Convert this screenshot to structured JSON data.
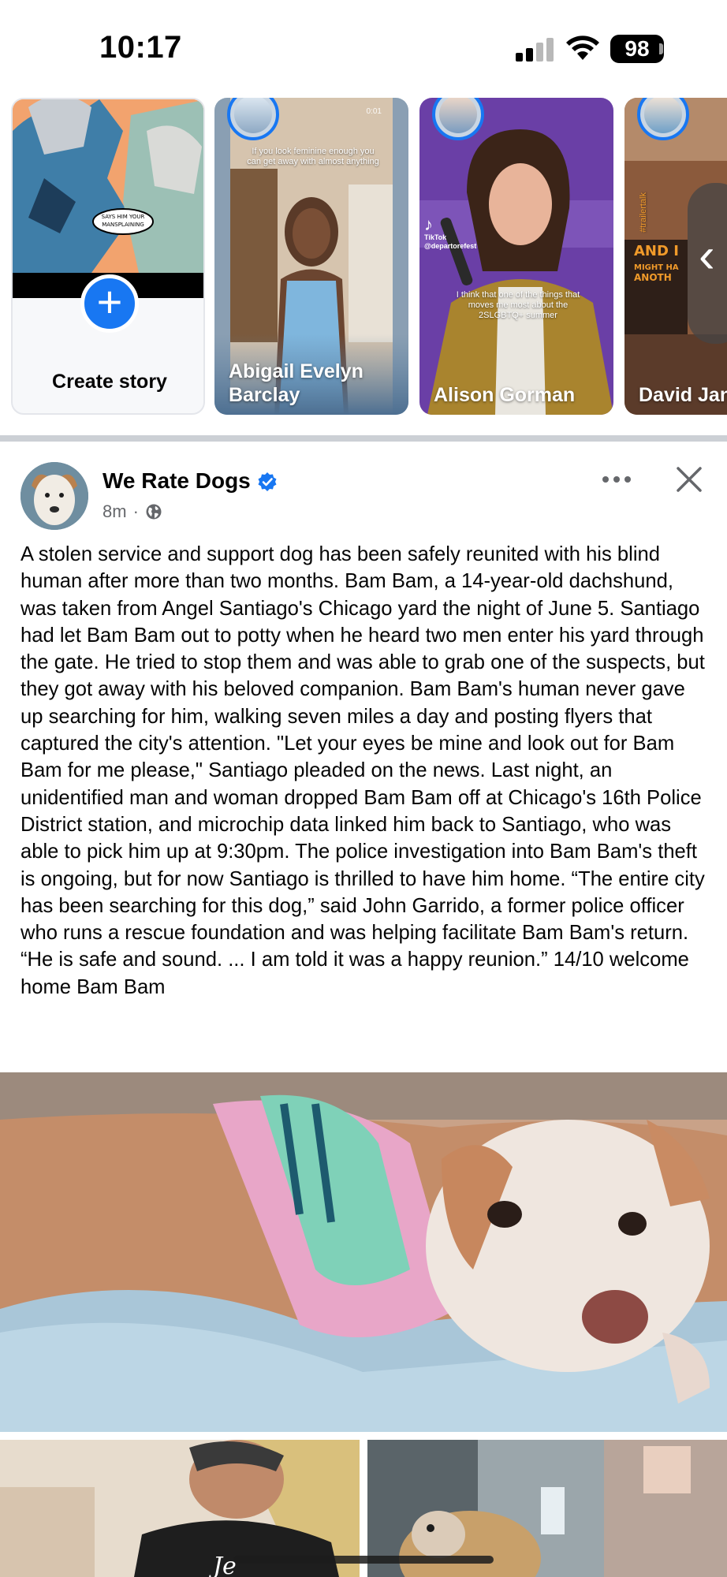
{
  "status_bar": {
    "time": "10:17",
    "battery": "98"
  },
  "stories": {
    "create_label": "Create story",
    "comic_text": "IT SAYS \"HIM YOUR MANSPLAINING\"",
    "items": [
      {
        "name": "Abigail Evelyn Barclay",
        "caption": "If you look feminine enough you can get away with almost anything",
        "time": "0:01"
      },
      {
        "name": "Alison Gorman",
        "caption": "I think that one of the things that moves me most about the 2SLGBTQ+ summer",
        "tiktok_label": "TikTok",
        "tiktok_handle": "@departorefest"
      },
      {
        "name": "David Jan Lewis",
        "tag": "#trailertalk"
      }
    ]
  },
  "post": {
    "author": "We Rate Dogs",
    "time": "8m",
    "body": "A stolen service and support dog has been safely reunited with his blind human after more than two months. Bam Bam, a 14-year-old dachshund, was taken from Angel Santiago's Chicago yard the night of June 5. Santiago had let Bam Bam out to potty when he heard two men enter his yard through the gate. He tried to stop them and was able to grab one of the suspects, but they got away with his beloved companion. Bam Bam's human never gave up searching for him, walking seven miles a day and posting flyers that captured the city's attention. \"Let your eyes be mine and look out for Bam Bam for me please,\" Santiago pleaded on the news. Last night, an unidentified man and woman dropped Bam Bam off at Chicago's 16th Police District station, and microchip data linked him back to Santiago, who was able to pick him up at 9:30pm. The police investigation into Bam Bam's theft is ongoing, but for now Santiago is thrilled to have him home. “The entire city has been searching for this dog,” said John Garrido, a former police officer who runs a rescue foundation and was helping facilitate Bam Bam's return. “He is safe and sound. ... I am told it was a happy reunion.” 14/10 welcome home Bam Bam"
  },
  "colors": {
    "accent": "#1877f2",
    "secondary_text": "#65676b",
    "divider": "#ccd0d5"
  },
  "icons": [
    "signal-icon",
    "wifi-icon",
    "battery-icon",
    "plus-icon",
    "verified-icon",
    "globe-icon",
    "more-icon",
    "close-icon",
    "chevron-left-icon"
  ]
}
